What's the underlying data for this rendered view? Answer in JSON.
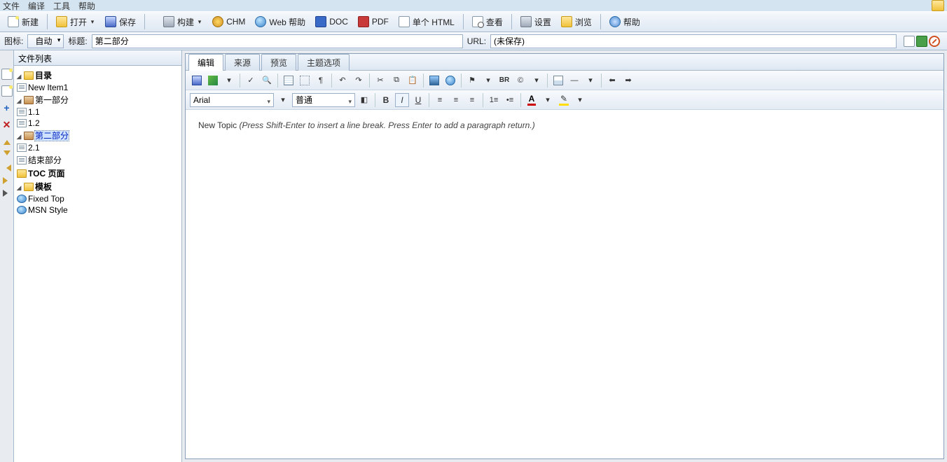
{
  "menu": {
    "file": "文件",
    "compile": "编译",
    "tools": "工具",
    "help": "帮助"
  },
  "tb1": {
    "new": "新建",
    "open": "打开",
    "save": "保存",
    "build": "构建",
    "chm": "CHM",
    "webhelp": "Web 帮助",
    "doc": "DOC",
    "pdf": "PDF",
    "singlehtml": "单个 HTML",
    "view": "查看",
    "settings": "设置",
    "browse": "浏览",
    "help": "帮助"
  },
  "tb2": {
    "icon_label": "图标:",
    "icon_value": "自动",
    "title_label": "标题:",
    "title_value": "第二部分",
    "url_label": "URL:",
    "url_value": "(未保存)"
  },
  "sidebar": {
    "header": "文件列表",
    "root": "目录",
    "items": {
      "newitem1": "New Item1",
      "part1": "第一部分",
      "p11": "1.1",
      "p12": "1.2",
      "part2": "第二部分",
      "p21": "2.1",
      "end": "结束部分"
    },
    "tocpages": "TOC 页面",
    "templates": "模板",
    "tmpl1": "Fixed Top",
    "tmpl2": "MSN Style"
  },
  "tabs": {
    "edit": "编辑",
    "source": "来源",
    "preview": "预览",
    "topicopts": "主题选项"
  },
  "etool": {
    "font": "Arial",
    "style": "普通",
    "br": "BR"
  },
  "content": {
    "title": "New Topic ",
    "hint": "(Press Shift-Enter to insert a line break. Press Enter to add a paragraph return.)"
  }
}
